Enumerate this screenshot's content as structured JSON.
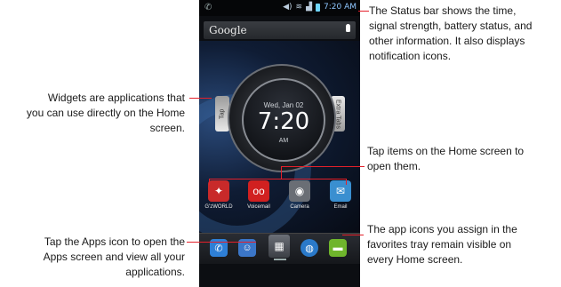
{
  "phone": {
    "status_bar": {
      "left": "✆",
      "time": "7:20 AM"
    },
    "search": {
      "label": "Google"
    },
    "clock": {
      "date": "Wed, Jan 02",
      "time": "7:20",
      "ampm": "AM"
    },
    "tabs": {
      "left": "Tap",
      "right": "Extra Tabs"
    },
    "apps": [
      {
        "label": "G'zWORLD",
        "icon": "world-app-icon",
        "color": "#c82a2a"
      },
      {
        "label": "Voicemail",
        "icon": "voicemail-icon",
        "color": "#d12020"
      },
      {
        "label": "Camera",
        "icon": "camera-icon",
        "color": "#6a6e75"
      },
      {
        "label": "Email",
        "icon": "email-icon",
        "color": "#3a8fd0"
      }
    ],
    "tray": [
      {
        "icon": "phone-icon",
        "color": "#2e7fd6"
      },
      {
        "icon": "contacts-icon",
        "color": "#3b76c8"
      },
      {
        "icon": "apps-grid-icon",
        "color": "#555a62"
      },
      {
        "icon": "browser-globe-icon",
        "color": "#2a79c9"
      },
      {
        "icon": "messaging-icon",
        "color": "#6fb52c"
      }
    ]
  },
  "callouts": {
    "status_bar": [
      "The Status bar shows the time,",
      "signal strength, battery status, and",
      "other information. It also displays",
      "notification icons."
    ],
    "widgets": [
      "Widgets are applications that",
      "you can use directly on the Home",
      "screen."
    ],
    "tap_items": [
      "Tap items on the Home screen to",
      "open them."
    ],
    "app_icons": [
      "The app icons you assign in the",
      "favorites tray remain visible on",
      "every Home screen."
    ],
    "apps_icon": [
      "Tap the Apps icon to open the",
      "Apps screen and view all your",
      "applications."
    ]
  },
  "colors": {
    "accent": "#e4202a"
  }
}
